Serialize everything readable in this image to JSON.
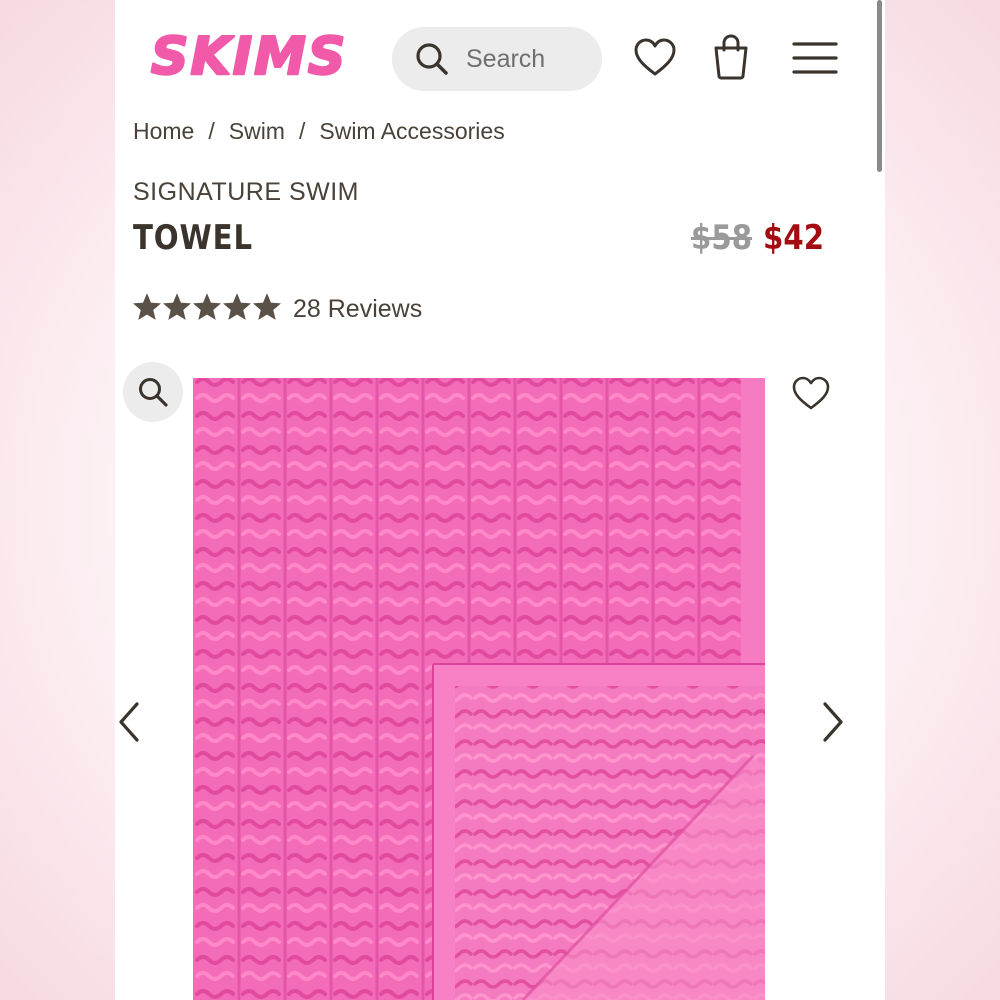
{
  "header": {
    "logo_text": "SKIMS",
    "brand_color": "#f05aa8",
    "search_placeholder": "Search",
    "icons": [
      "search-icon",
      "heart-icon",
      "shopping-bag-icon",
      "hamburger-menu-icon"
    ]
  },
  "breadcrumb": {
    "items": [
      "Home",
      "Swim",
      "Swim Accessories"
    ],
    "separator": "/"
  },
  "product": {
    "collection": "SIGNATURE SWIM",
    "name": "TOWEL",
    "original_price": "$58",
    "sale_price": "$42",
    "sale_color": "#a30d12",
    "rating": 5,
    "rating_max": 5,
    "reviews_label": "28 Reviews",
    "image_color": "#f06bb5"
  },
  "gallery": {
    "icons": [
      "magnifier-icon",
      "heart-icon",
      "chevron-left-icon",
      "chevron-right-icon"
    ]
  }
}
